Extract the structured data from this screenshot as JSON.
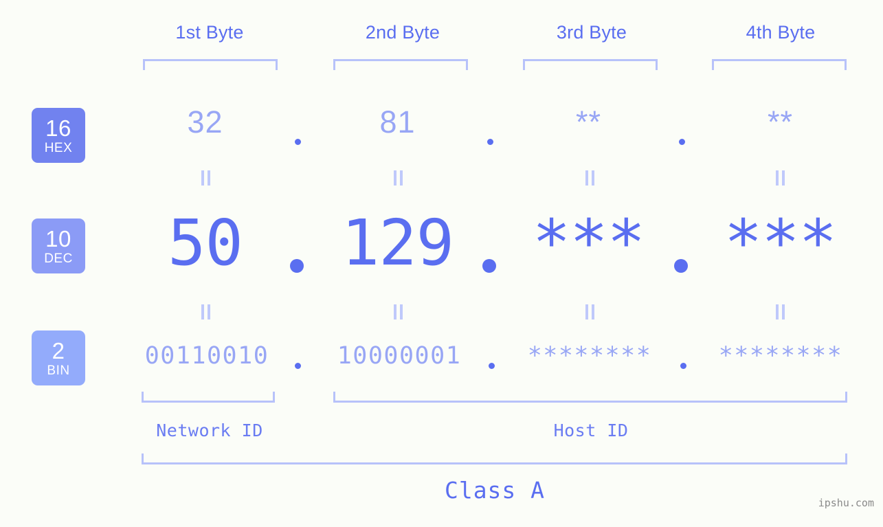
{
  "meta": {
    "background_color": "#fbfdf8",
    "accent_strong": "#5a6ef0",
    "accent_light": "#98a6f5",
    "bracket_color": "#b7c2fa",
    "watermark_color": "#8a8a8a"
  },
  "byte_headers": [
    {
      "label": "1st Byte"
    },
    {
      "label": "2nd Byte"
    },
    {
      "label": "3rd Byte"
    },
    {
      "label": "4th Byte"
    }
  ],
  "bases": [
    {
      "number": "16",
      "name": "HEX",
      "color": "#7182ef"
    },
    {
      "number": "10",
      "name": "DEC",
      "color": "#8b9bf6"
    },
    {
      "number": "2",
      "name": "BIN",
      "color": "#93abfb"
    }
  ],
  "rows": {
    "hex": {
      "base_number": "16",
      "base_name": "HEX",
      "values": [
        "32",
        "81",
        "**",
        "**"
      ],
      "separator": "."
    },
    "dec": {
      "base_number": "10",
      "base_name": "DEC",
      "values": [
        "50",
        "129",
        "***",
        "***"
      ],
      "separator": "."
    },
    "bin": {
      "base_number": "2",
      "base_name": "BIN",
      "values": [
        "00110010",
        "10000001",
        "********",
        "********"
      ],
      "separator": "."
    }
  },
  "equals_marks": {
    "glyph": "||",
    "count_per_gap": 4,
    "gaps": 2
  },
  "footer": {
    "network_id_label": "Network ID",
    "host_id_label": "Host ID",
    "class_label": "Class A"
  },
  "watermark": {
    "text": "ipshu.com"
  }
}
